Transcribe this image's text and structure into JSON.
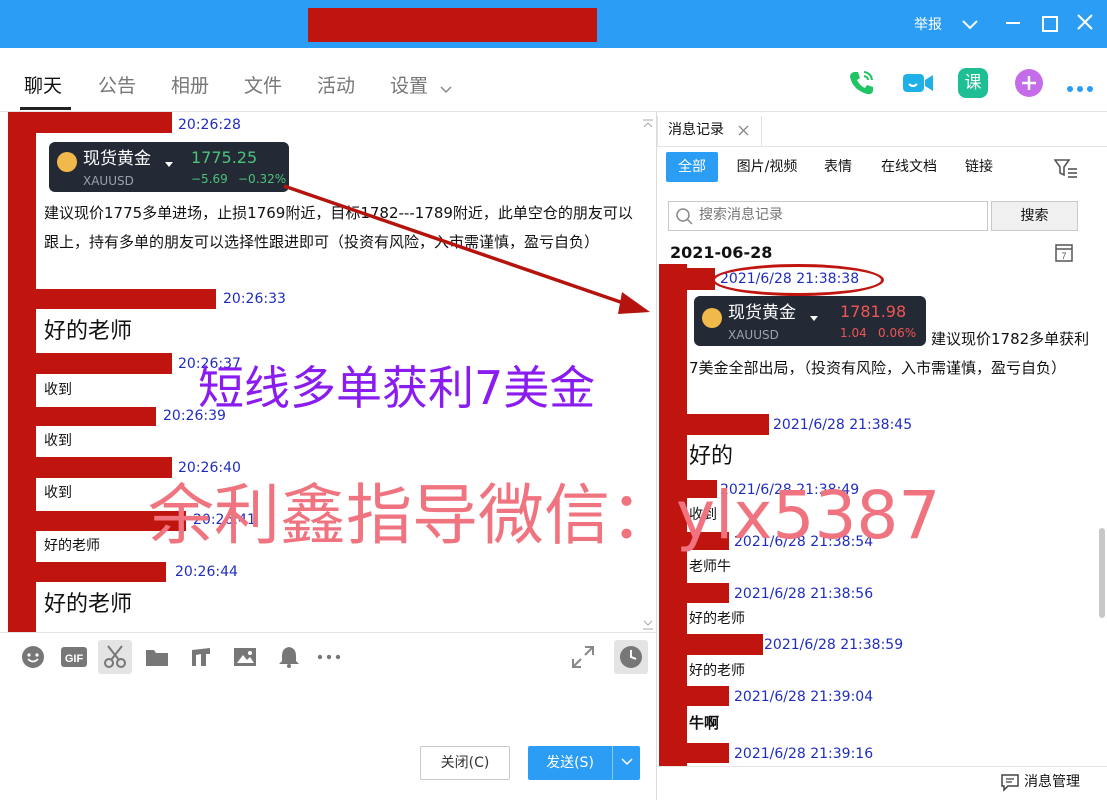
{
  "titlebar": {
    "report": "举报",
    "collapse_icon": "chevron-down-icon",
    "minimize_icon": "minimize-icon",
    "maximize_icon": "maximize-icon",
    "close_icon": "close-icon",
    "bg": "#2b9df4",
    "redaction": "#c0150f"
  },
  "tabs": [
    {
      "label": "聊天"
    },
    {
      "label": "公告"
    },
    {
      "label": "相册"
    },
    {
      "label": "文件"
    },
    {
      "label": "活动"
    },
    {
      "label": "设置"
    }
  ],
  "header_icons": [
    "phone-icon",
    "video-icon",
    "lesson-icon",
    "add-icon",
    "more-icon"
  ],
  "lesson_label": "课",
  "chat": {
    "messages": [
      {
        "time": "20:26:28",
        "card": {
          "name": "现货黄金",
          "symbol": "XAUUSD",
          "price": "1775.25",
          "change": "−5.69",
          "pct": "−0.32%"
        },
        "text": "建议现价1775多单进场，止损1769附近，目标1782---1789附近，此单空仓的朋友可以跟上，持有多单的朋友可以选择性跟进即可（投资有风险，入市需谨慎，盈亏自负）"
      },
      {
        "time": "20:26:33",
        "text": "好的老师"
      },
      {
        "time": "20:26:37",
        "text": "收到"
      },
      {
        "time": "20:26:39",
        "text": "收到"
      },
      {
        "time": "20:26:40",
        "text": "收到"
      },
      {
        "time": "20:26:41",
        "text": "好的老师"
      },
      {
        "time": "20:26:44",
        "text": "好的老师"
      }
    ]
  },
  "toolbar": {
    "icons": [
      "emoji-icon",
      "gif-icon",
      "scissors-icon",
      "folder-icon",
      "music-icon",
      "image-icon",
      "bell-icon",
      "more-icon"
    ],
    "gif_label": "GIF",
    "expand_icon": "expand-icon",
    "history_icon": "clock-icon",
    "close_label": "关闭(C)",
    "send_label": "发送(S)"
  },
  "history": {
    "tab_label": "消息记录",
    "filters": [
      "全部",
      "图片/视频",
      "表情",
      "在线文档",
      "链接"
    ],
    "search_placeholder": "搜索消息记录",
    "search_button": "搜索",
    "date": "2021-06-28",
    "messages": [
      {
        "time": "2021/6/28 21:38:38",
        "card": {
          "name": "现货黄金",
          "symbol": "XAUUSD",
          "price": "1781.98",
          "change": "1.04",
          "pct": "0.06%"
        },
        "text": "建议现价1782多单获利7美金全部出局，（投资有风险，入市需谨慎，盈亏自负）"
      },
      {
        "time": "2021/6/28 21:38:45",
        "text": "好的"
      },
      {
        "time": "2021/6/28 21:38:49",
        "text": "收到"
      },
      {
        "time": "2021/6/28 21:38:54",
        "text": "老师牛"
      },
      {
        "time": "2021/6/28 21:38:56",
        "text": "好的老师"
      },
      {
        "time": "2021/6/28 21:38:59",
        "text": "好的老师"
      },
      {
        "time": "2021/6/28 21:39:04",
        "text": "牛啊"
      },
      {
        "time": "2021/6/28 21:39:16",
        "text": ""
      }
    ],
    "manage_label": "消息管理"
  },
  "overlays": {
    "line1": "短线多单获利7美金",
    "line2": "余利鑫指导微信：ylx5387"
  },
  "colors": {
    "accent": "#2b9df4",
    "timestamp": "#1f2dbf",
    "redaction": "#c0150f",
    "price_up": "#4cc27a",
    "price_down": "#f05454"
  }
}
